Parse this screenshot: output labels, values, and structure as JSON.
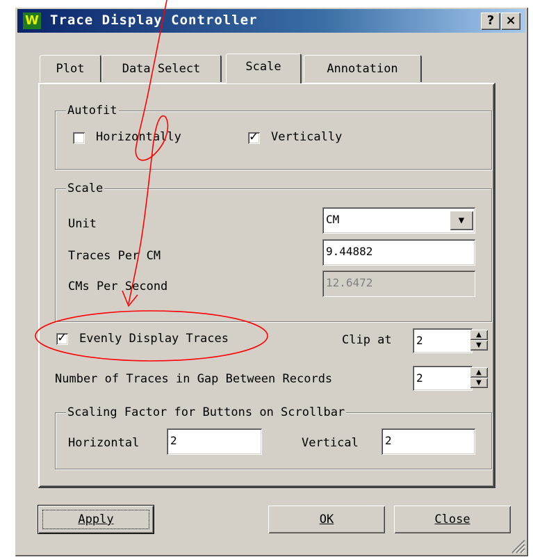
{
  "window": {
    "title": "Trace Display Controller",
    "help_button": "?",
    "close_button": "×"
  },
  "tabs": [
    {
      "label": "Plot",
      "active": false
    },
    {
      "label": "Data Select",
      "active": false
    },
    {
      "label": "Scale",
      "active": true
    },
    {
      "label": "Annotation",
      "active": false
    }
  ],
  "autofit": {
    "legend": "Autofit",
    "horizontally": {
      "label": "Horizontally",
      "checked": false
    },
    "vertically": {
      "label": "Vertically",
      "checked": true
    }
  },
  "scale": {
    "legend": "Scale",
    "unit_label": "Unit",
    "unit_value": "CM",
    "traces_per_cm_label": "Traces Per CM",
    "traces_per_cm_value": "9.44882",
    "cms_per_second_label": "CMs Per Second",
    "cms_per_second_value": "12.6472"
  },
  "evenly_display": {
    "label": "Evenly Display Traces",
    "checked": true
  },
  "clip": {
    "label": "Clip at",
    "value": "2"
  },
  "gap": {
    "label": "Number of Traces in Gap Between Records",
    "value": "2"
  },
  "scrollbar_scaling": {
    "legend": "Scaling Factor for Buttons on Scrollbar",
    "horizontal_label": "Horizontal",
    "horizontal_value": "2",
    "vertical_label": "Vertical",
    "vertical_value": "2"
  },
  "buttons": {
    "apply": "Apply",
    "ok": "OK",
    "close": "Close"
  },
  "annotation_color": "#ff0000",
  "titlebar_color": "#0a246a"
}
